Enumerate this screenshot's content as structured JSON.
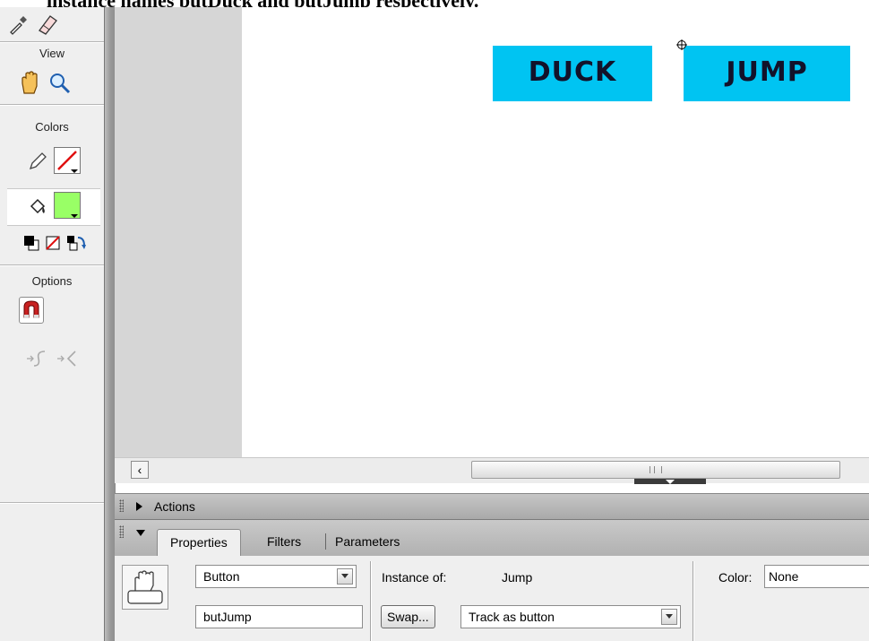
{
  "caption": {
    "text": "instance names butDuck and butJump respectively."
  },
  "tools": {
    "view_label": "View",
    "colors_label": "Colors",
    "options_label": "Options",
    "stroke_color": "none",
    "fill_color": "#99ff66",
    "icons": [
      "eyedropper-icon",
      "eraser-icon",
      "hand-icon",
      "zoom-icon",
      "pencil-icon",
      "paint-bucket-icon",
      "black-white-icon",
      "no-color-icon",
      "swap-colors-icon",
      "snap-magnet-icon",
      "smooth-icon",
      "straighten-icon"
    ]
  },
  "stage": {
    "duck_button": "DUCK",
    "jump_button": "JUMP",
    "button_color": "#00c4f2"
  },
  "panels": {
    "actions_label": "Actions",
    "tabs": {
      "properties": "Properties",
      "filters": "Filters",
      "parameters": "Parameters"
    },
    "symbol_behavior": "Button",
    "instance_name": "butJump",
    "instance_of_label": "Instance of:",
    "instance_of_value": "Jump",
    "swap_label": "Swap...",
    "tracking": "Track as button",
    "color_label": "Color:",
    "color_value": "None"
  }
}
